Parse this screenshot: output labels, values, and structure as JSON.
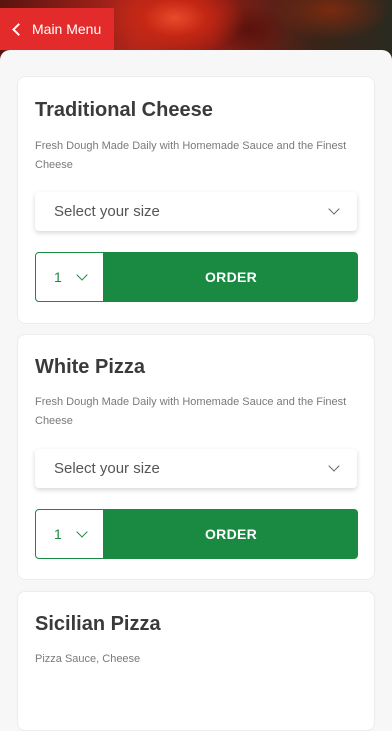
{
  "header": {
    "back_label": "Main Menu"
  },
  "items": [
    {
      "title": "Traditional Cheese",
      "description": "Fresh Dough Made Daily with Homemade Sauce and the Finest Cheese",
      "size_placeholder": "Select your size",
      "quantity": "1",
      "order_label": "ORDER"
    },
    {
      "title": "White Pizza",
      "description": "Fresh Dough Made Daily with Homemade Sauce and the Finest Cheese",
      "size_placeholder": "Select your size",
      "quantity": "1",
      "order_label": "ORDER"
    },
    {
      "title": "Sicilian Pizza",
      "description": "Pizza Sauce, Cheese"
    }
  ],
  "colors": {
    "accent_red": "#e32b2b",
    "order_green": "#1a8a43"
  }
}
